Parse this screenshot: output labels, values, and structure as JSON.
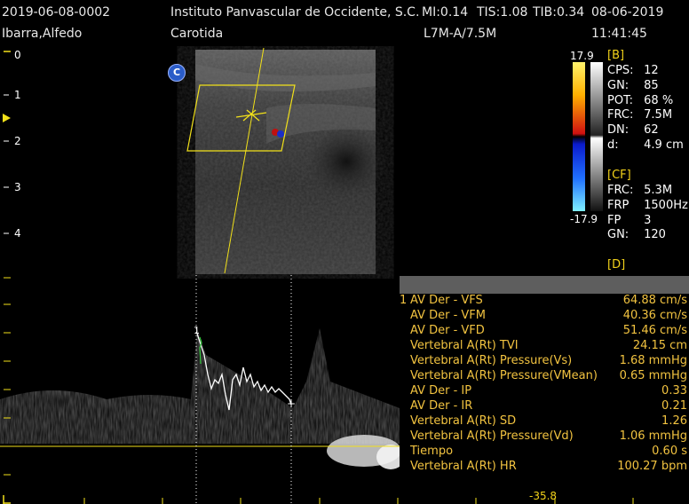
{
  "header": {
    "patient_id": "2019-06-08-0002",
    "institution": "Instituto Panvascular de Occidente, S.C.",
    "mi": "MI:0.14",
    "tis": "TIS:1.08",
    "tib": "TIB:0.34",
    "date": "08-06-2019",
    "patient_name": "Ibarra,Alfedo",
    "exam": "Carotida",
    "probe": "L7M-A/7.5M",
    "time": "11:41:45"
  },
  "colorbar": {
    "top": "17.9",
    "bottom": "-17.9"
  },
  "c_badge": "C",
  "depth_scale": [
    "0",
    "1",
    "2",
    "3",
    "4"
  ],
  "b_params": {
    "title": "[B]",
    "items": [
      {
        "k": "CPS:",
        "v": "12"
      },
      {
        "k": "GN:",
        "v": "85"
      },
      {
        "k": "POT:",
        "v": "68 %"
      },
      {
        "k": "FRC:",
        "v": "7.5M"
      },
      {
        "k": "DN:",
        "v": "62"
      },
      {
        "k": "d:",
        "v": "4.9 cm"
      }
    ]
  },
  "cf_params": {
    "title": "[CF]",
    "items": [
      {
        "k": "FRC:",
        "v": "5.3M"
      },
      {
        "k": "FRP",
        "v": "1500Hz"
      },
      {
        "k": "FP",
        "v": "3"
      },
      {
        "k": "GN:",
        "v": "120"
      }
    ]
  },
  "d_params": {
    "title": "[D]"
  },
  "cursor_markers": [
    "1",
    "+"
  ],
  "spectral_velocity_label": "-35.8",
  "measurements": {
    "group_number": "1",
    "rows": [
      {
        "label": "AV Der - VFS",
        "value": "64.88 cm/s"
      },
      {
        "label": "AV Der - VFM",
        "value": "40.36 cm/s"
      },
      {
        "label": "AV Der - VFD",
        "value": "51.46 cm/s"
      },
      {
        "label": "Vertebral A(Rt) TVI",
        "value": "24.15 cm"
      },
      {
        "label": "Vertebral A(Rt) Pressure(Vs)",
        "value": "1.68 mmHg"
      },
      {
        "label": "Vertebral A(Rt) Pressure(VMean)",
        "value": "0.65 mmHg"
      },
      {
        "label": "AV Der - IP",
        "value": "0.33"
      },
      {
        "label": "AV Der - IR",
        "value": "0.21"
      },
      {
        "label": "Vertebral A(Rt) SD",
        "value": "1.26"
      },
      {
        "label": "Vertebral A(Rt) Pressure(Vd)",
        "value": "1.06 mmHg"
      },
      {
        "label": "Tiempo",
        "value": "0.60 s"
      },
      {
        "label": "Vertebral A(Rt) HR",
        "value": "100.27 bpm"
      }
    ]
  },
  "colors": {
    "accent_yellow": "#f2d21a",
    "measure_text": "#f2c340",
    "measure_header": "#5e5e5e",
    "doppler_trace": "#ffffff"
  }
}
